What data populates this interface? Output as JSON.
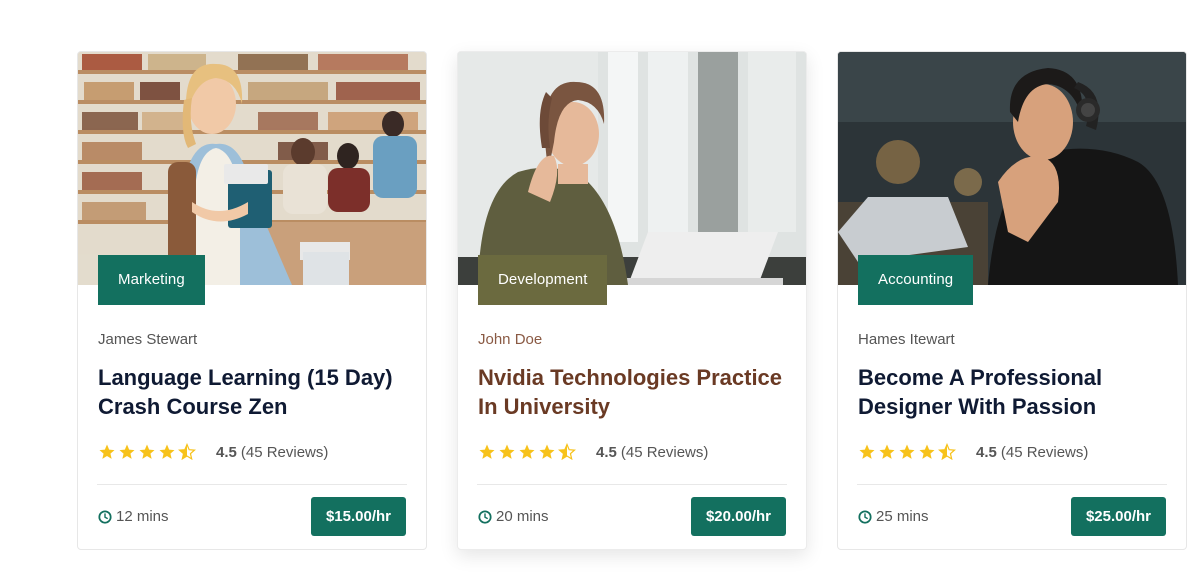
{
  "colors": {
    "accent": "#13705f",
    "development_tag": "#6b6a3f",
    "star": "#f7c21a",
    "title": "#0f1a33",
    "highlight_title": "#6a3a24"
  },
  "courses": [
    {
      "category": "Marketing",
      "category_color": "#13705f",
      "author": "James Stewart",
      "title": "Language Learning (15 Day) Crash Course Zen",
      "rating": "4.5",
      "reviews": "(45 Reviews)",
      "duration": "12 mins",
      "price": "$15.00/hr",
      "image": "student-in-library-photo"
    },
    {
      "category": "Development",
      "category_color": "#6b6a3f",
      "author": "John Doe",
      "title": "Nvidia Technologies Practice In University",
      "rating": "4.5",
      "reviews": "(45 Reviews)",
      "duration": "20 mins",
      "price": "$20.00/hr",
      "image": "woman-with-laptop-photo"
    },
    {
      "category": "Accounting",
      "category_color": "#13705f",
      "author": "Hames Itewart",
      "title": "Become A Professional Designer With Passion",
      "rating": "4.5",
      "reviews": "(45 Reviews)",
      "duration": "25 mins",
      "price": "$25.00/hr",
      "image": "man-with-headphones-photo"
    }
  ],
  "icons": {
    "star": "star-icon",
    "half_star": "star-half-icon",
    "clock": "clock-icon"
  }
}
